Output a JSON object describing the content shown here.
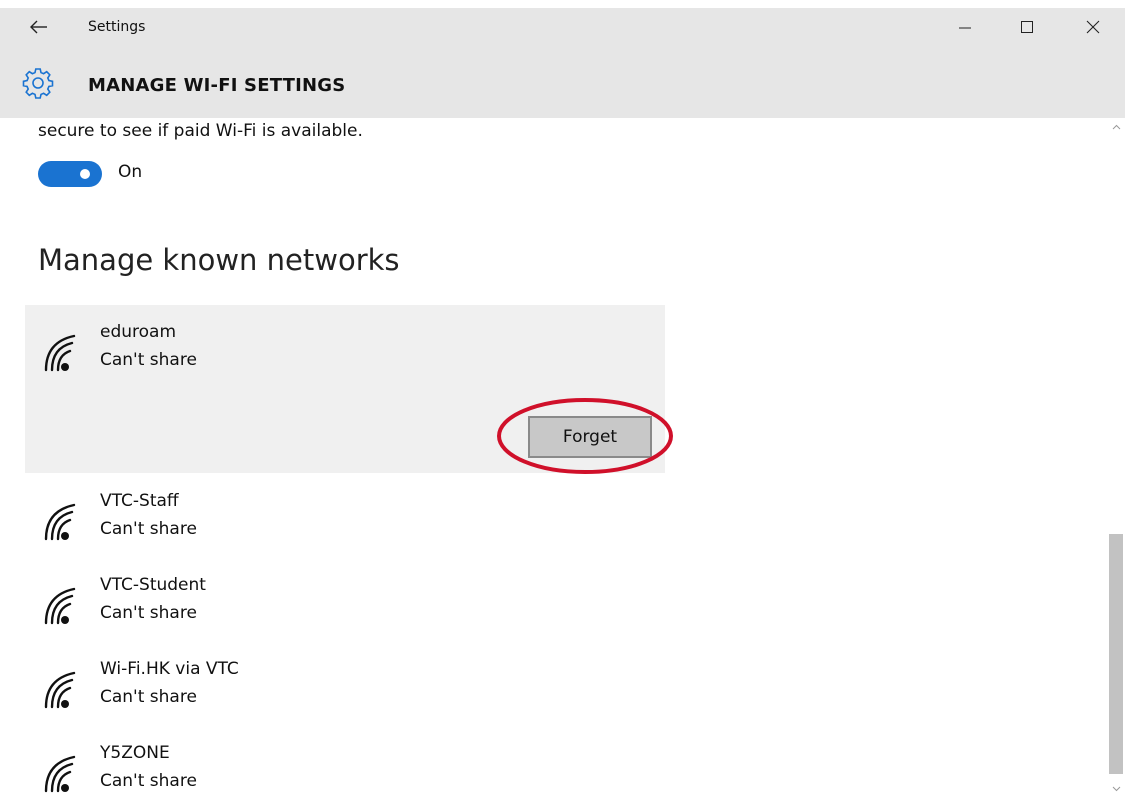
{
  "window": {
    "app_title": "Settings",
    "back_icon": "back-arrow-icon",
    "minimize_icon": "minimize-icon",
    "maximize_icon": "maximize-icon",
    "close_icon": "close-icon"
  },
  "header": {
    "icon": "gear-icon",
    "title": "MANAGE WI-FI SETTINGS"
  },
  "paid_wifi": {
    "description": "secure to see if paid Wi-Fi is available.",
    "toggle_state": "On",
    "toggle_on": true,
    "accent_color": "#1a73d1"
  },
  "known_networks": {
    "heading": "Manage known networks",
    "selected_index": 0,
    "forget_label": "Forget",
    "highlight_color": "#d0102a",
    "items": [
      {
        "name": "eduroam",
        "status": "Can't share",
        "icon": "wifi-signal-icon"
      },
      {
        "name": "VTC-Staff",
        "status": "Can't share",
        "icon": "wifi-signal-icon"
      },
      {
        "name": "VTC-Student",
        "status": "Can't share",
        "icon": "wifi-signal-icon"
      },
      {
        "name": "Wi-Fi.HK via VTC",
        "status": "Can't share",
        "icon": "wifi-signal-icon"
      },
      {
        "name": "Y5ZONE",
        "status": "Can't share",
        "icon": "wifi-signal-icon"
      }
    ]
  }
}
